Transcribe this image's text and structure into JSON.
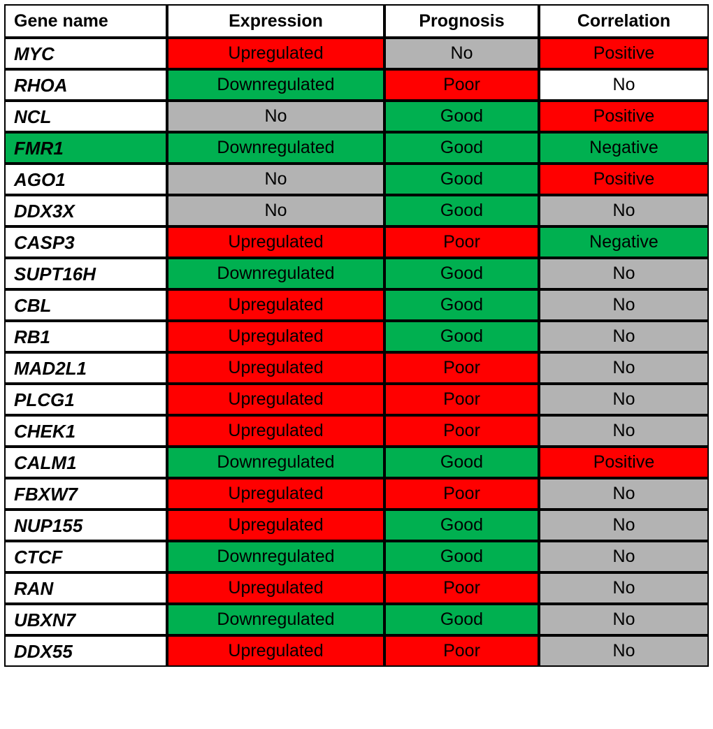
{
  "table": {
    "columns": [
      {
        "key": "gene",
        "label": "Gene name"
      },
      {
        "key": "expr",
        "label": "Expression"
      },
      {
        "key": "prog",
        "label": "Prognosis"
      },
      {
        "key": "corr",
        "label": "Correlation"
      }
    ],
    "colors": {
      "red": "#ff0000",
      "green": "#00b050",
      "gray": "#b3b3b3",
      "white": "#ffffff",
      "border": "#000000"
    },
    "rows": [
      {
        "gene": "MYC",
        "gene_fill": "white",
        "expr": "Upregulated",
        "expr_fill": "red",
        "prog": "No",
        "prog_fill": "gray",
        "corr": "Positive",
        "corr_fill": "red"
      },
      {
        "gene": "RHOA",
        "gene_fill": "white",
        "expr": "Downregulated",
        "expr_fill": "green",
        "prog": "Poor",
        "prog_fill": "red",
        "corr": "No",
        "corr_fill": "white"
      },
      {
        "gene": "NCL",
        "gene_fill": "white",
        "expr": "No",
        "expr_fill": "gray",
        "prog": "Good",
        "prog_fill": "green",
        "corr": "Positive",
        "corr_fill": "red"
      },
      {
        "gene": "FMR1",
        "gene_fill": "green",
        "expr": "Downregulated",
        "expr_fill": "green",
        "prog": "Good",
        "prog_fill": "green",
        "corr": "Negative",
        "corr_fill": "green"
      },
      {
        "gene": "AGO1",
        "gene_fill": "white",
        "expr": "No",
        "expr_fill": "gray",
        "prog": "Good",
        "prog_fill": "green",
        "corr": "Positive",
        "corr_fill": "red"
      },
      {
        "gene": "DDX3X",
        "gene_fill": "white",
        "expr": "No",
        "expr_fill": "gray",
        "prog": "Good",
        "prog_fill": "green",
        "corr": "No",
        "corr_fill": "gray"
      },
      {
        "gene": "CASP3",
        "gene_fill": "white",
        "expr": "Upregulated",
        "expr_fill": "red",
        "prog": "Poor",
        "prog_fill": "red",
        "corr": "Negative",
        "corr_fill": "green"
      },
      {
        "gene": "SUPT16H",
        "gene_fill": "white",
        "expr": "Downregulated",
        "expr_fill": "green",
        "prog": "Good",
        "prog_fill": "green",
        "corr": "No",
        "corr_fill": "gray"
      },
      {
        "gene": "CBL",
        "gene_fill": "white",
        "expr": "Upregulated",
        "expr_fill": "red",
        "prog": "Good",
        "prog_fill": "green",
        "corr": "No",
        "corr_fill": "gray"
      },
      {
        "gene": "RB1",
        "gene_fill": "white",
        "expr": "Upregulated",
        "expr_fill": "red",
        "prog": "Good",
        "prog_fill": "green",
        "corr": "No",
        "corr_fill": "gray"
      },
      {
        "gene": "MAD2L1",
        "gene_fill": "white",
        "expr": "Upregulated",
        "expr_fill": "red",
        "prog": "Poor",
        "prog_fill": "red",
        "corr": "No",
        "corr_fill": "gray"
      },
      {
        "gene": "PLCG1",
        "gene_fill": "white",
        "expr": "Upregulated",
        "expr_fill": "red",
        "prog": "Poor",
        "prog_fill": "red",
        "corr": "No",
        "corr_fill": "gray"
      },
      {
        "gene": "CHEK1",
        "gene_fill": "white",
        "expr": "Upregulated",
        "expr_fill": "red",
        "prog": "Poor",
        "prog_fill": "red",
        "corr": "No",
        "corr_fill": "gray"
      },
      {
        "gene": "CALM1",
        "gene_fill": "white",
        "expr": "Downregulated",
        "expr_fill": "green",
        "prog": "Good",
        "prog_fill": "green",
        "corr": "Positive",
        "corr_fill": "red"
      },
      {
        "gene": "FBXW7",
        "gene_fill": "white",
        "expr": "Upregulated",
        "expr_fill": "red",
        "prog": "Poor",
        "prog_fill": "red",
        "corr": "No",
        "corr_fill": "gray"
      },
      {
        "gene": "NUP155",
        "gene_fill": "white",
        "expr": "Upregulated",
        "expr_fill": "red",
        "prog": "Good",
        "prog_fill": "green",
        "corr": "No",
        "corr_fill": "gray"
      },
      {
        "gene": "CTCF",
        "gene_fill": "white",
        "expr": "Downregulated",
        "expr_fill": "green",
        "prog": "Good",
        "prog_fill": "green",
        "corr": "No",
        "corr_fill": "gray"
      },
      {
        "gene": "RAN",
        "gene_fill": "white",
        "expr": "Upregulated",
        "expr_fill": "red",
        "prog": "Poor",
        "prog_fill": "red",
        "corr": "No",
        "corr_fill": "gray"
      },
      {
        "gene": "UBXN7",
        "gene_fill": "white",
        "expr": "Downregulated",
        "expr_fill": "green",
        "prog": "Good",
        "prog_fill": "green",
        "corr": "No",
        "corr_fill": "gray"
      },
      {
        "gene": "DDX55",
        "gene_fill": "white",
        "expr": "Upregulated",
        "expr_fill": "red",
        "prog": "Poor",
        "prog_fill": "red",
        "corr": "No",
        "corr_fill": "gray"
      }
    ]
  }
}
